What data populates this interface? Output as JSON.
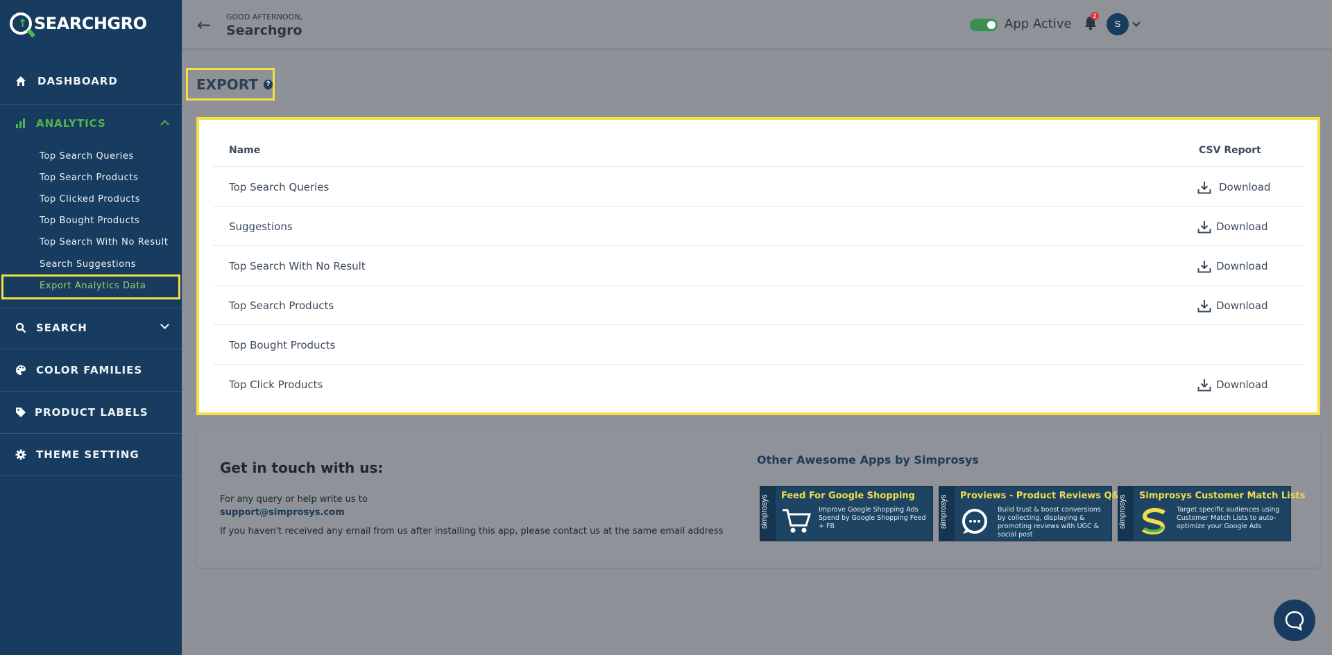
{
  "app": {
    "logo_text": "SEARCHGRO"
  },
  "sidebar": {
    "dashboard": "DASHBOARD",
    "analytics": "ANALYTICS",
    "analytics_items": [
      "Top Search Queries",
      "Top Search Products",
      "Top Clicked Products",
      "Top Bought Products",
      "Top Search With No Result",
      "Search Suggestions",
      "Export Analytics Data"
    ],
    "search": "SEARCH",
    "color_families": "COLOR FAMILIES",
    "product_labels": "PRODUCT LABELS",
    "theme_setting": "THEME SETTING"
  },
  "header": {
    "greeting": "GOOD AFTERNOON,",
    "store_name": "Searchgro",
    "app_status": "App Active",
    "notification_count": "2",
    "avatar_initial": "S"
  },
  "page": {
    "title": "EXPORT",
    "help": "?"
  },
  "table": {
    "col_name": "Name",
    "col_csv": "CSV Report",
    "download_label": "Download",
    "rows": [
      {
        "name": "Top Search Queries",
        "download": "Download"
      },
      {
        "name": "Suggestions",
        "download": "Download"
      },
      {
        "name": "Top Search With No Result",
        "download": "Download"
      },
      {
        "name": "Top Search Products",
        "download": "Download"
      },
      {
        "name": "Top Bought Products",
        "download": ""
      },
      {
        "name": "Top Click Products",
        "download": "Download"
      }
    ]
  },
  "footer": {
    "title": "Get in touch with us:",
    "line1": "For any query or help write us to",
    "email": "support@simprosys.com",
    "line2": "If you haven't received any email from us after installing this app, please contact us at the same email address",
    "apps_title": "Other Awesome Apps by Simprosys",
    "brand": "simprosys",
    "apps": [
      {
        "title": "Feed For Google Shopping",
        "desc": "Improve Google Shopping Ads Spend by Google Shopping Feed + FB"
      },
      {
        "title": "Proviews - Product Reviews Q&A",
        "desc": "Build trust & boost conversions by collecting, displaying & promoting reviews with UGC & social post"
      },
      {
        "title": "Simprosys Customer Match Lists",
        "desc": "Target specific audiences using Customer Match Lists to auto-optimize your Google Ads"
      }
    ]
  }
}
